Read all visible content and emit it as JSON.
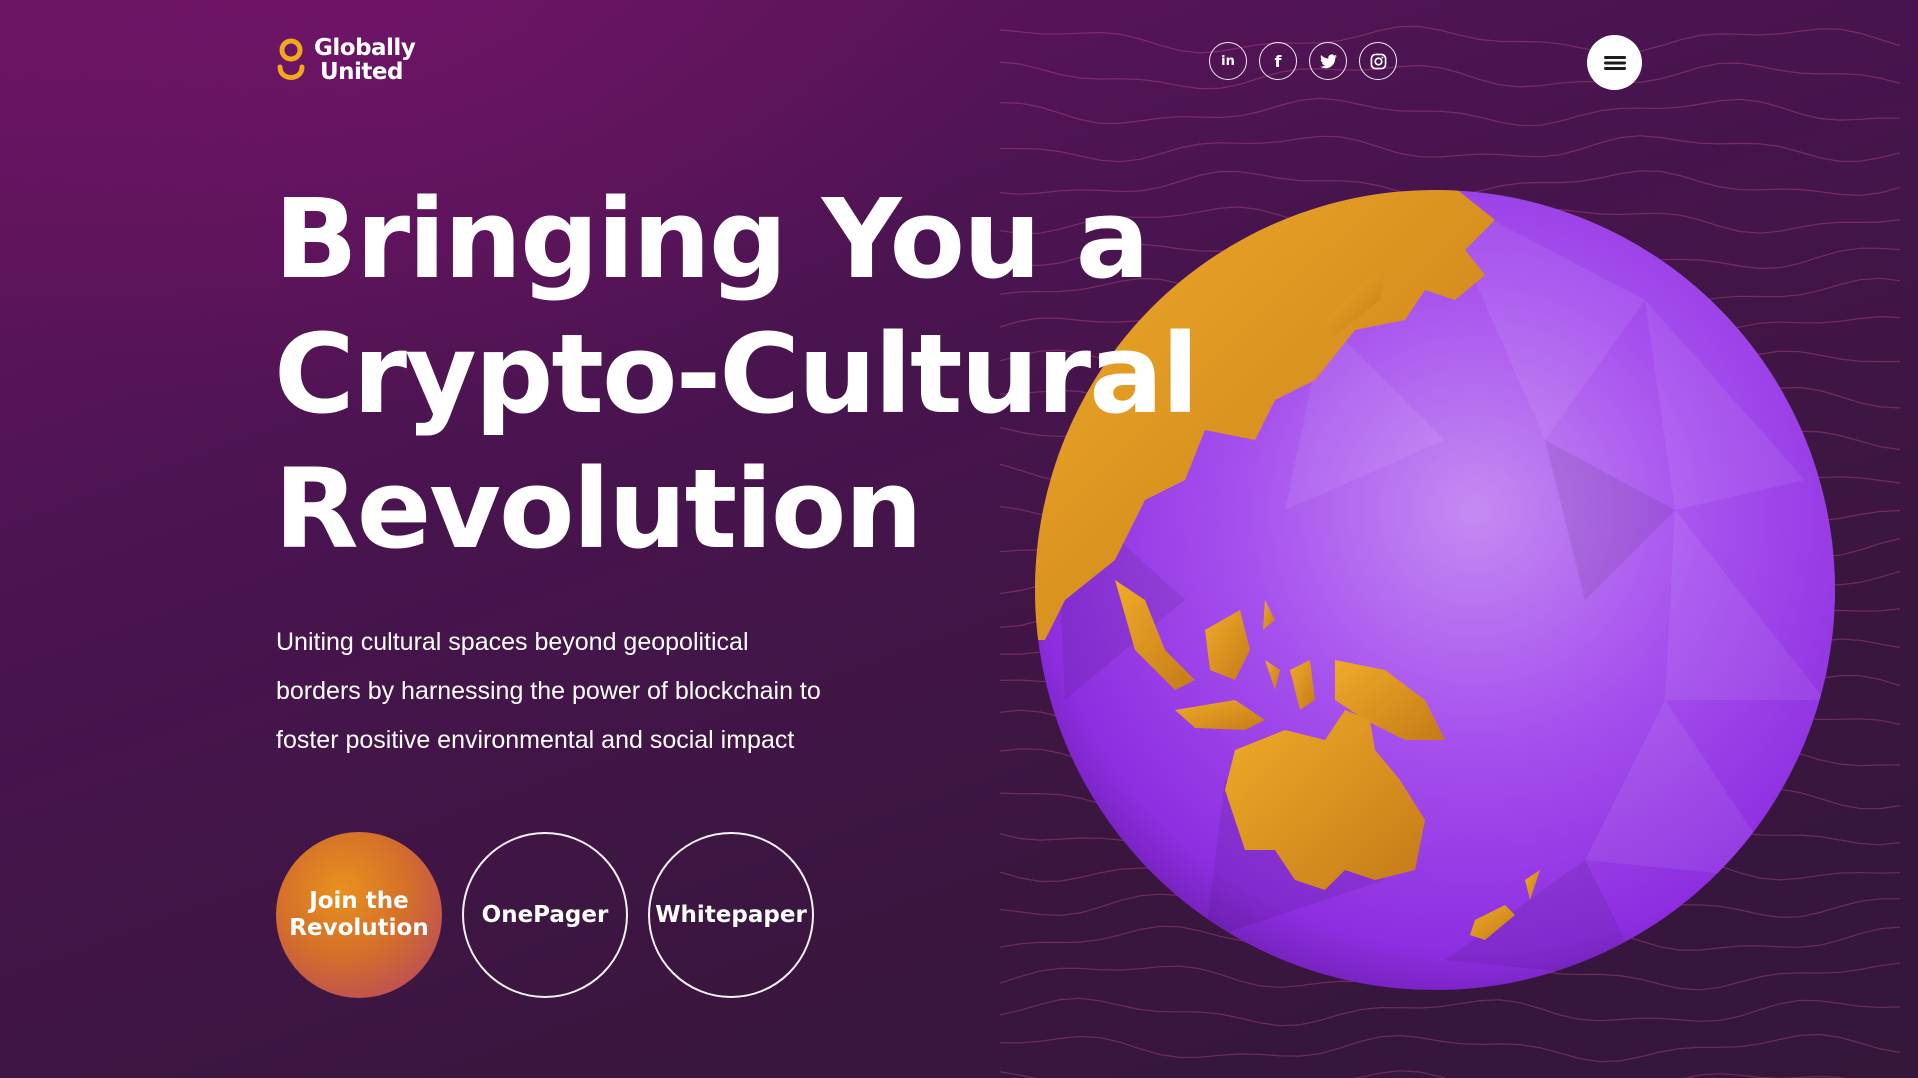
{
  "brand": {
    "name_line1": "Globally",
    "name_line2": "United",
    "accent_color": "#f2a81d"
  },
  "social": [
    {
      "name": "linkedin",
      "glyph": "in"
    },
    {
      "name": "facebook",
      "glyph": "f"
    },
    {
      "name": "twitter",
      "glyph": "twitter-bird"
    },
    {
      "name": "instagram",
      "glyph": "instagram-camera"
    }
  ],
  "menu": {
    "icon": "hamburger-icon"
  },
  "hero": {
    "title_line1": "Bringing You a",
    "title_line2": "Crypto-Cultural",
    "title_line3": "Revolution",
    "subtitle_line1": "Uniting cultural spaces beyond geopolitical",
    "subtitle_line2": "borders by harnessing the power of blockchain to",
    "subtitle_line3": "foster positive environmental and social impact"
  },
  "cta": {
    "join_line1": "Join the",
    "join_line2": "Revolution",
    "onepager": "OnePager",
    "whitepaper": "Whitepaper"
  },
  "colors": {
    "background": "#3a163f",
    "globe_purple": "#9b3ee8",
    "globe_land": "#e69a1c"
  }
}
